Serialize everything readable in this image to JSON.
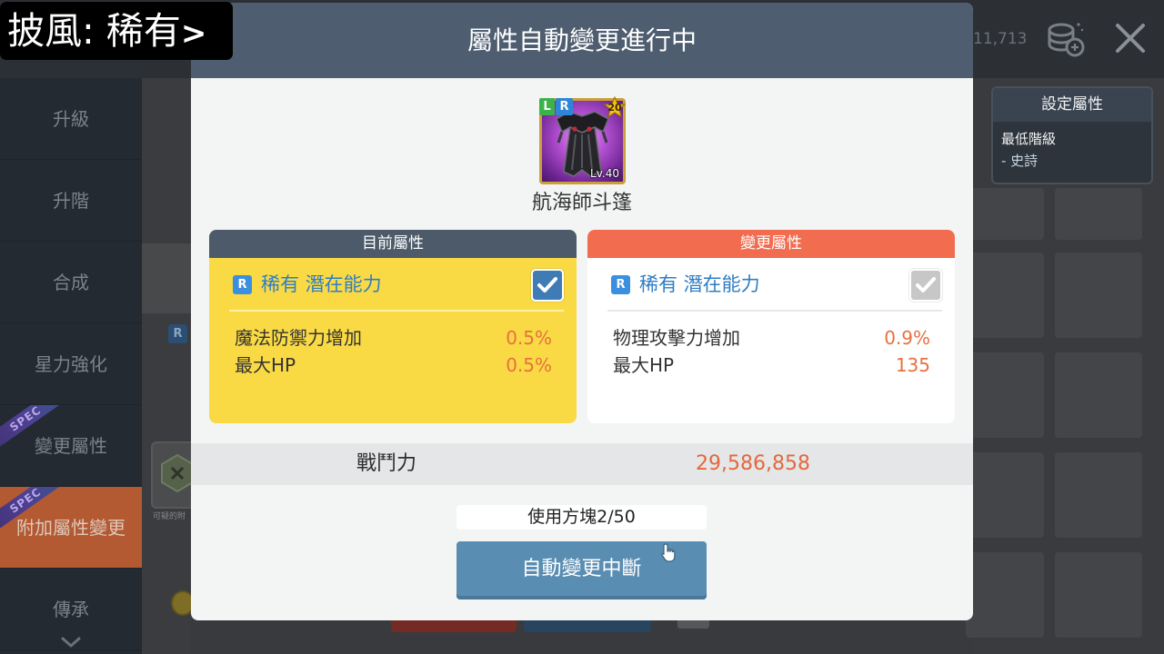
{
  "caption": {
    "text": "披風: 稀有",
    "arrow": ">"
  },
  "topbar": {
    "currency_value": "11,713",
    "currency_icon": "meso-stack-icon",
    "close_icon": "close-icon"
  },
  "sidebar": {
    "items": [
      {
        "label": "升級"
      },
      {
        "label": "升階"
      },
      {
        "label": "合成"
      },
      {
        "label": "星力強化"
      },
      {
        "label": "變更屬性",
        "badge": "SPEC"
      },
      {
        "label": "附加屬性變更",
        "badge": "SPEC",
        "active": true
      },
      {
        "label": "傳承"
      }
    ],
    "more_icon": "chevron-down-icon"
  },
  "settings_panel": {
    "title": "設定屬性",
    "label": "最低階級",
    "value": "- 史詩"
  },
  "background_list": {
    "grade_badge": "R",
    "item_caption": "可疑的附",
    "coin_icon": "coin-icon"
  },
  "modal": {
    "title": "屬性自動變更進行中",
    "item": {
      "name": "航海師斗篷",
      "badge_left": "L",
      "badge_right": "R",
      "star_force": "20",
      "level": "Lv.40",
      "icon": "cloak-icon"
    },
    "current": {
      "header": "目前屬性",
      "grade_badge": "R",
      "grade": "稀有 潛在能力",
      "checked": true,
      "stats": [
        {
          "name": "魔法防禦力增加",
          "value": "0.5%"
        },
        {
          "name": "最大HP",
          "value": "0.5%"
        }
      ]
    },
    "changed": {
      "header": "變更屬性",
      "grade_badge": "R",
      "grade": "稀有 潛在能力",
      "checked": true,
      "enabled": false,
      "stats": [
        {
          "name": "物理攻擊力增加",
          "value": "0.9%"
        },
        {
          "name": "最大HP",
          "value": "135"
        }
      ]
    },
    "combat_power": {
      "label": "戰鬥力",
      "value": "29,586,858"
    },
    "cube_usage": "使用方塊2/50",
    "stop_button": "自動變更中斷"
  },
  "cursor_icon": "pointer-hand-icon",
  "colors": {
    "modal_header": "#4e5d6f",
    "current_header": "#4d5a6a",
    "current_body": "#f9da45",
    "changed_header": "#f26c4f",
    "grade_text": "#2f7dc3",
    "stat_value": "#e8703f",
    "combat_value": "#e2693f",
    "stop_button": "#5a8db2",
    "sidebar_active": "#b35a33"
  }
}
